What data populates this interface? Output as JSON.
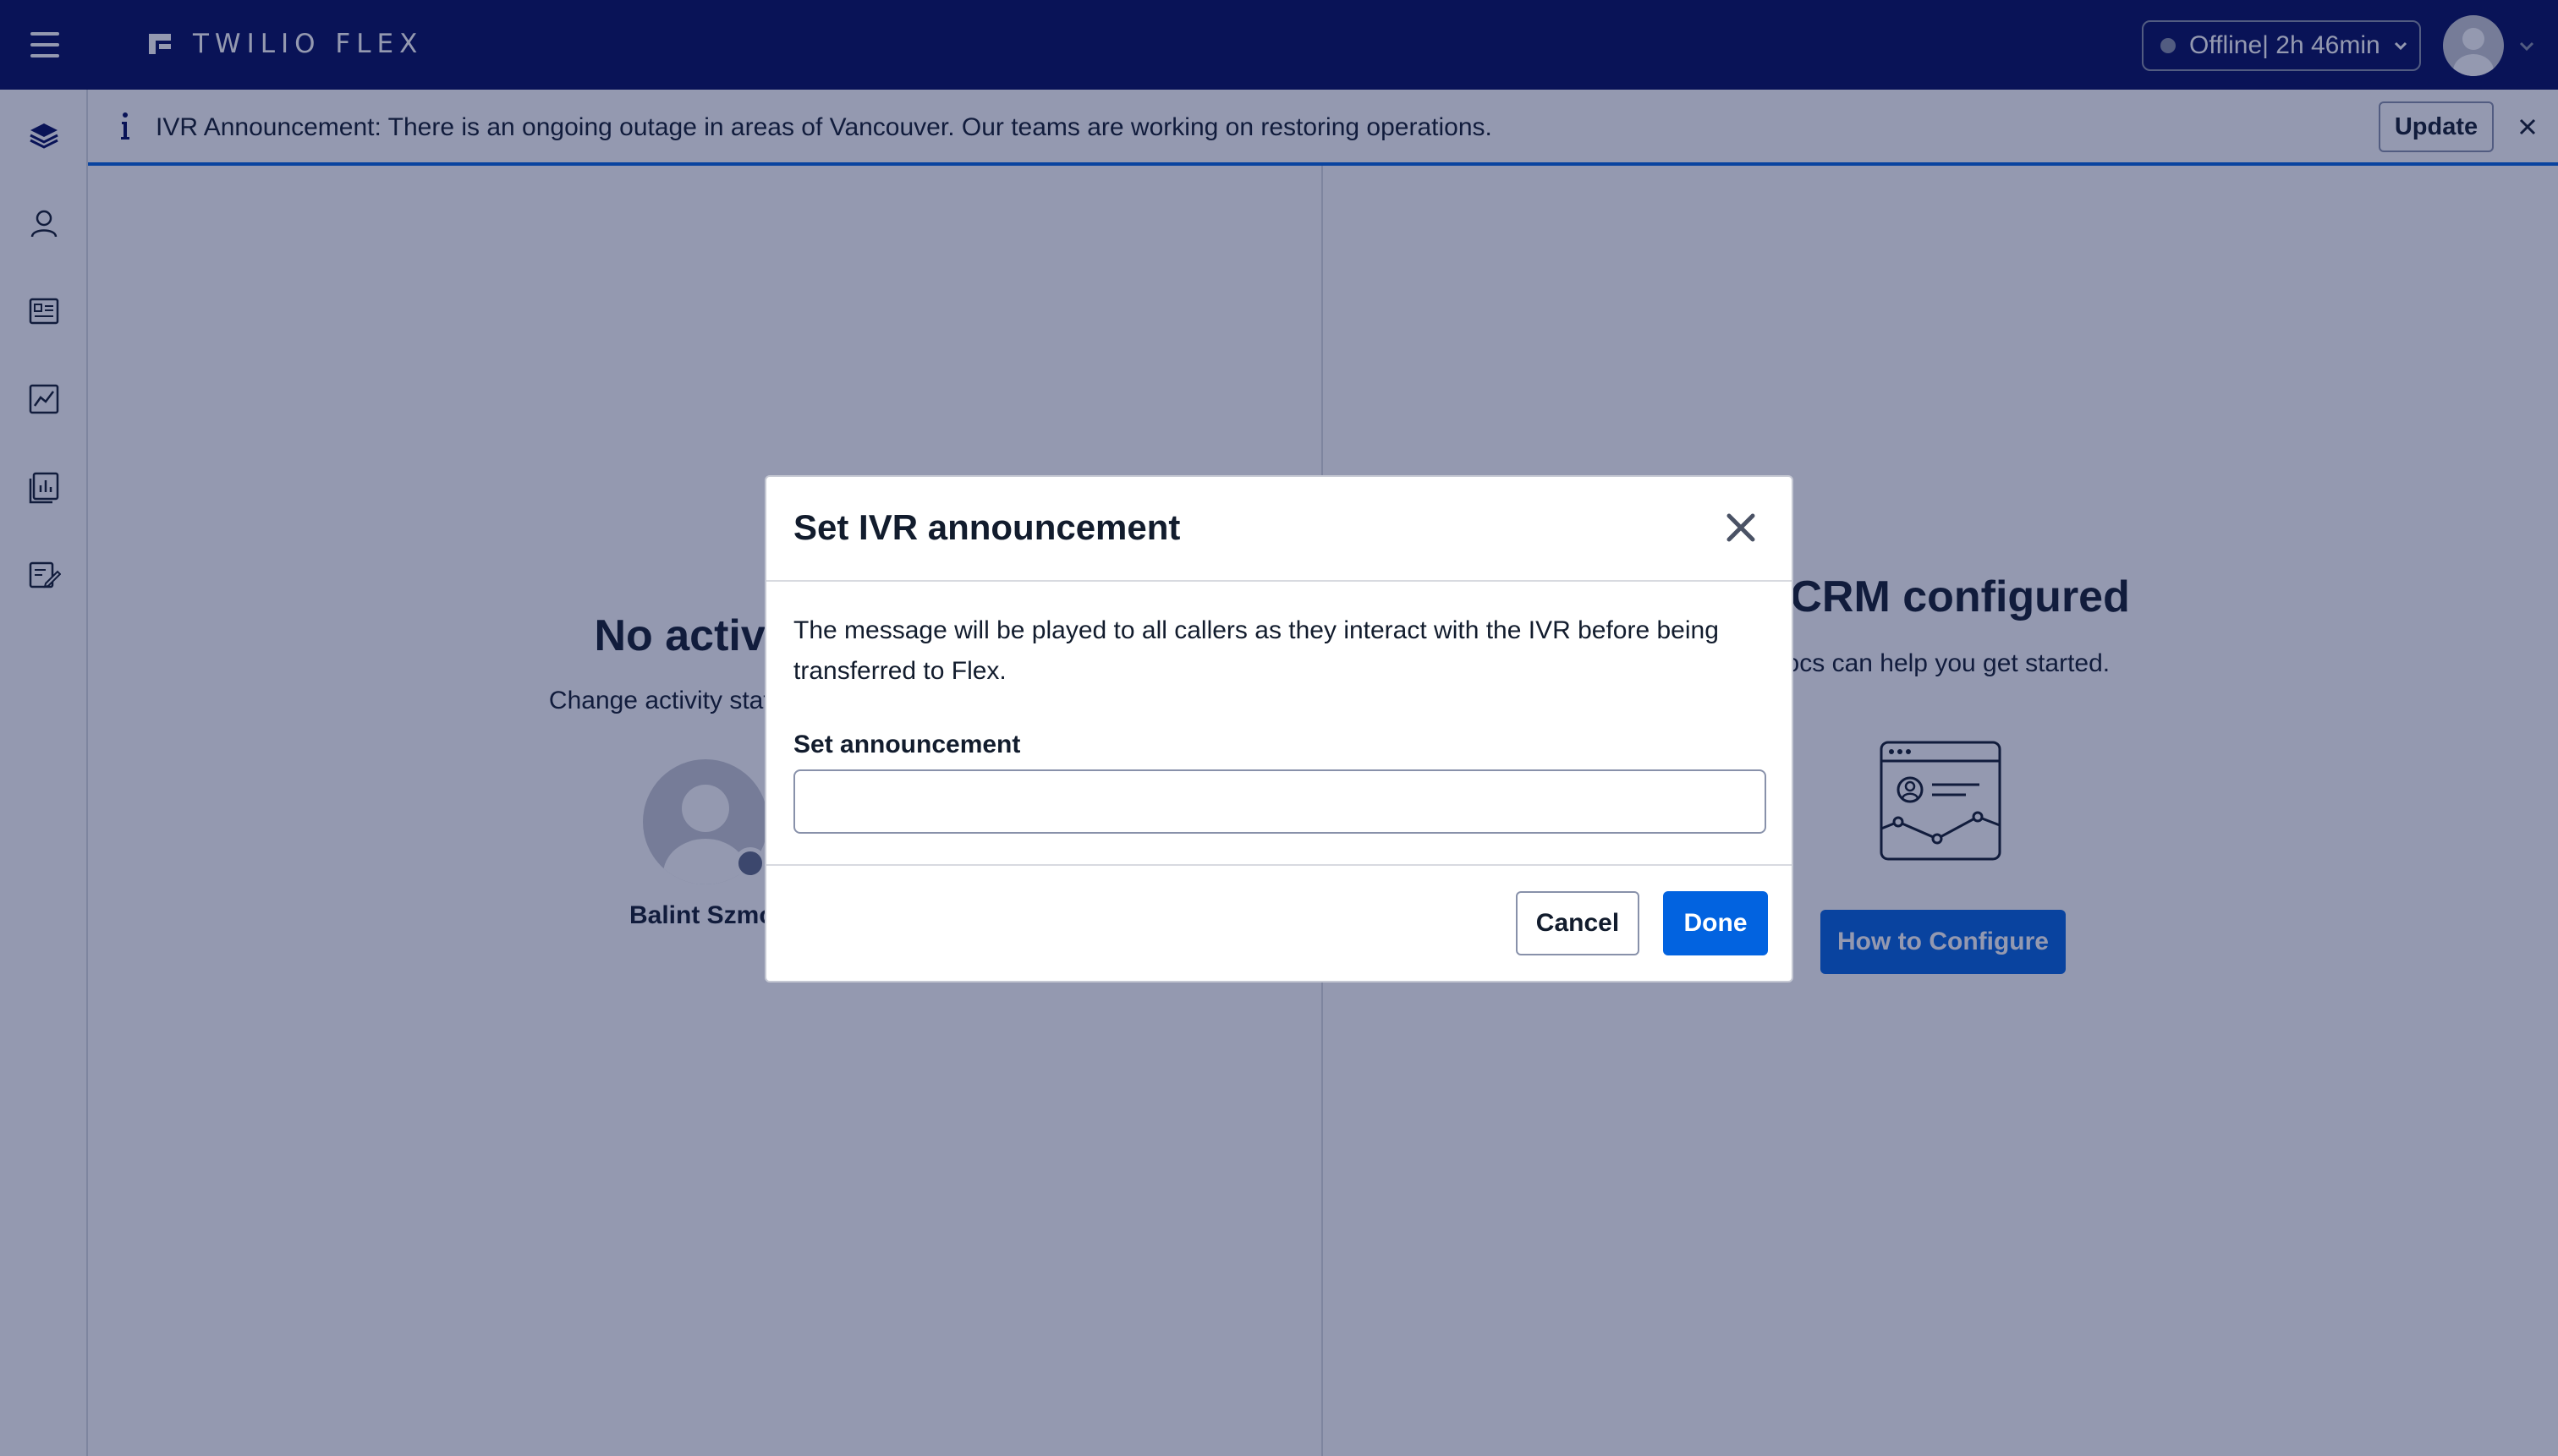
{
  "topbar": {
    "brand": "TWILIO FLEX",
    "status": {
      "label": "Offline| 2h 46min"
    }
  },
  "sidebar": {
    "items": [
      {
        "icon": "layers-icon"
      },
      {
        "icon": "agents-icon"
      },
      {
        "icon": "queues-icon"
      },
      {
        "icon": "analytics-icon"
      },
      {
        "icon": "dashboards-icon"
      },
      {
        "icon": "edit-list-icon"
      }
    ]
  },
  "banner": {
    "text": "IVR Announcement: There is an ongoing outage in areas of Vancouver. Our teams are working on restoring operations.",
    "update_label": "Update"
  },
  "left_pane": {
    "title": "No active t",
    "subtitle": "Change activity state to star",
    "user_name": "Balint Szmol"
  },
  "right_pane": {
    "title": "o CRM configured",
    "subtitle": "docs can help you get started.",
    "button_label": "How to Configure"
  },
  "modal": {
    "title": "Set IVR announcement",
    "description": "The message will be played to all callers as they interact with the IVR before being transferred to Flex.",
    "field_label": "Set announcement",
    "field_value": "",
    "cancel_label": "Cancel",
    "done_label": "Done"
  },
  "colors": {
    "topbar_bg": "#030b5d",
    "accent_blue": "#0263e0",
    "overlay": "rgba(18,28,80,0.45)"
  }
}
